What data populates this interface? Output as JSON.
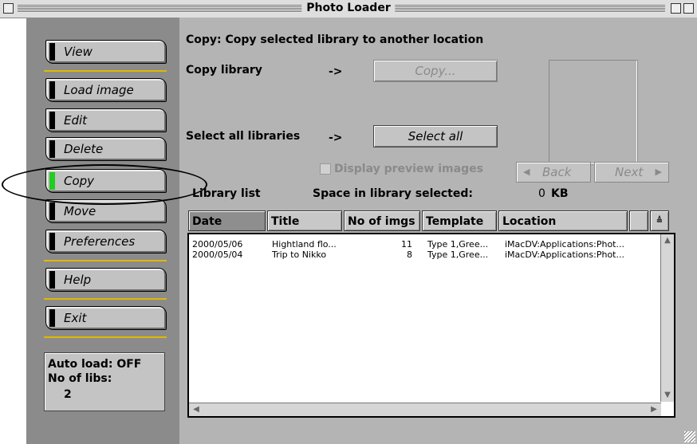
{
  "window": {
    "title": "Photo Loader"
  },
  "sidebar": {
    "items": [
      {
        "label": "View"
      },
      {
        "label": "Load image"
      },
      {
        "label": "Edit"
      },
      {
        "label": "Delete"
      },
      {
        "label": "Copy",
        "active": true
      },
      {
        "label": "Move"
      },
      {
        "label": "Preferences"
      },
      {
        "label": "Help"
      },
      {
        "label": "Exit"
      }
    ],
    "status": {
      "autoload_label": "Auto load: OFF",
      "libs_label": "No of libs:",
      "libs_count": "2"
    }
  },
  "main": {
    "heading": "Copy: Copy selected library to another location",
    "copy_library_label": "Copy library",
    "arrow1": "->",
    "copy_button": "Copy...",
    "select_all_label": "Select all libraries",
    "arrow2": "->",
    "select_all_button": "Select all",
    "display_preview_label": "Display preview images",
    "back_button": "Back",
    "next_button": "Next",
    "library_list_label": "Library list",
    "space_label": "Space in library selected:",
    "space_value": "0",
    "space_unit": "KB"
  },
  "table": {
    "headers": [
      "Date",
      "Title",
      "No of imgs",
      "Template",
      "Location"
    ],
    "rows": [
      [
        "2000/05/06",
        "Hightland flo...",
        "11",
        "Type 1,Gree...",
        "iMacDV:Applications:Phot..."
      ],
      [
        "2000/05/04",
        "Trip to Nikko",
        "8",
        "Type 1,Gree...",
        "iMacDV:Applications:Phot..."
      ]
    ]
  },
  "colors": {
    "active_indicator": "#22cc22",
    "separator": "#e0b800",
    "sidebar_bg": "#8b8b8b",
    "content_bg": "#b4b4b4"
  }
}
